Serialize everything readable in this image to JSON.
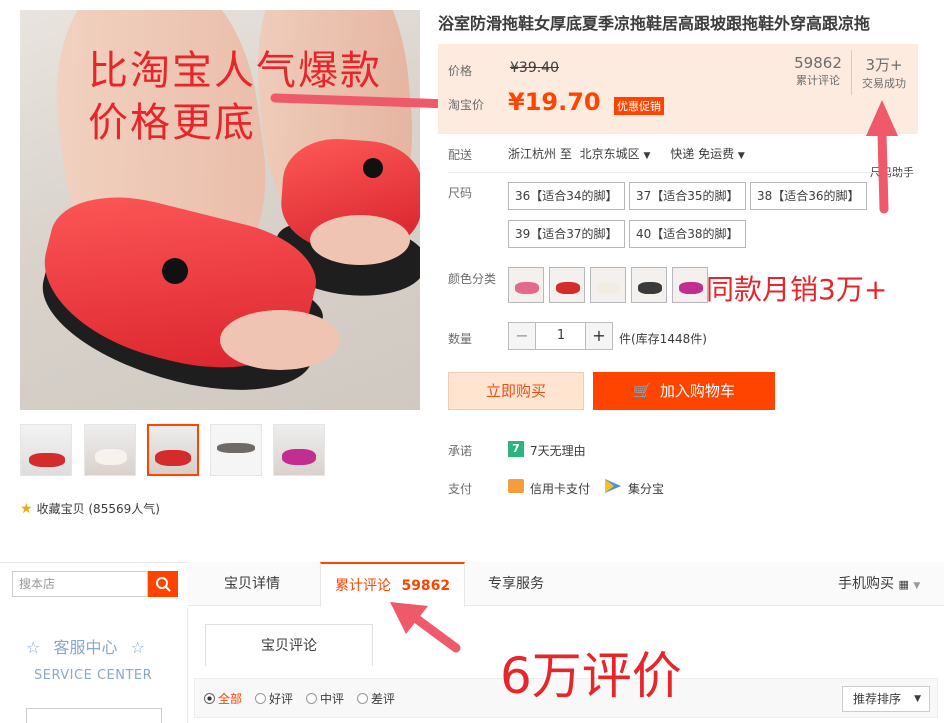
{
  "product": {
    "title": "浴室防滑拖鞋女厚底夏季凉拖鞋居高跟坡跟拖鞋外穿高跟凉拖",
    "price_label": "价格",
    "price_old": "¥39.40",
    "tb_price_label": "淘宝价",
    "price_new": "¥19.70",
    "promo_badge": "优惠促销",
    "review_count": "59862",
    "review_label": "累计评论",
    "sales_count": "3万+",
    "sales_label": "交易成功",
    "shipping_label": "配送",
    "ship_from": "浙江杭州 至",
    "ship_to": "北京东城区",
    "ship_method": "快递 免运费",
    "size_helper": "尺码助手",
    "size_label": "尺码",
    "sizes": [
      "36【适合34的脚】",
      "37【适合35的脚】",
      "38【适合36的脚】",
      "39【适合37的脚】",
      "40【适合38的脚】"
    ],
    "color_label": "颜色分类",
    "qty_label": "数量",
    "qty_value": "1",
    "qty_minus": "−",
    "qty_plus": "+",
    "stock_text": "件(库存1448件)",
    "buy_now": "立即购买",
    "add_cart": "加入购物车",
    "promise_label": "承诺",
    "promise_badge": "7",
    "promise_text": "7天无理由",
    "pay_label": "支付",
    "pay_card": "信用卡支付",
    "pay_jifen": "集分宝",
    "favorite": "收藏宝贝 (85569人气)"
  },
  "annotations": {
    "top_line1": "比淘宝人气爆款",
    "top_line2": "价格更底",
    "monthly": "同款月销3万+",
    "reviews": "6万评价"
  },
  "shop": {
    "search_placeholder": "搜本店",
    "service_title": "客服中心",
    "service_en": "SERVICE CENTER"
  },
  "tabs": [
    {
      "label": "宝贝详情"
    },
    {
      "label": "累计评论",
      "count": "59862"
    },
    {
      "label": "专享服务"
    }
  ],
  "mobile_buy": "手机购买",
  "review_tab": "宝贝评论",
  "filters": [
    "全部",
    "好评",
    "中评",
    "差评"
  ],
  "sort_label": "推荐排序",
  "colors": {
    "accent": "#ff4400",
    "annotation": "#e8252b",
    "price_bg": "#fdebe0"
  }
}
